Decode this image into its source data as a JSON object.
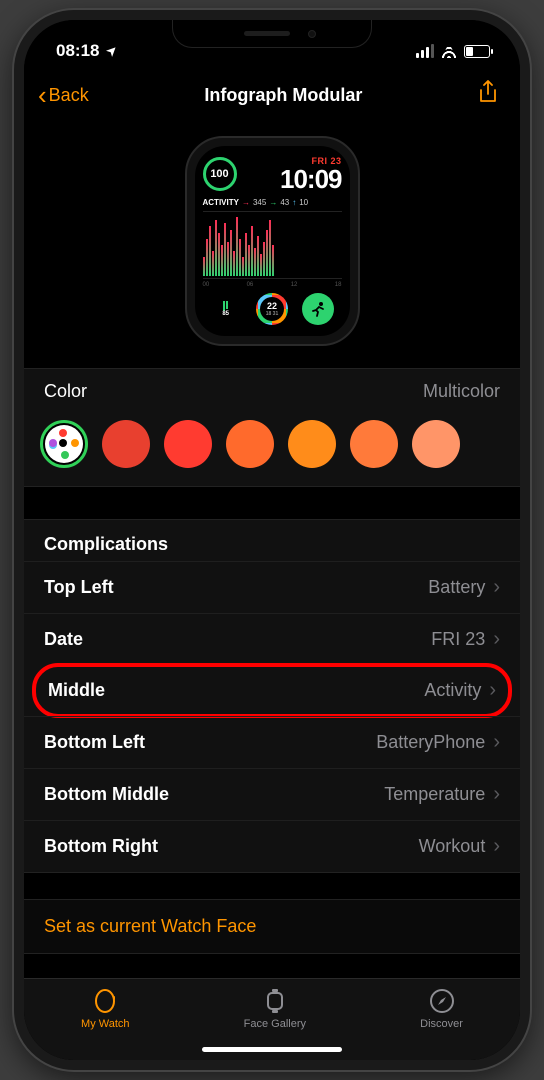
{
  "status": {
    "time": "08:18"
  },
  "nav": {
    "back": "Back",
    "title": "Infograph Modular"
  },
  "watchface": {
    "date_label": "FRI 23",
    "time": "10:09",
    "ring_value": "100",
    "activity_label": "ACTIVITY",
    "activity_move": "345",
    "activity_ex": "43",
    "activity_stand": "10",
    "graph_ticks": [
      "00",
      "06",
      "12",
      "18"
    ],
    "bottom_left_value": "85",
    "bottom_mid_value": "22",
    "bottom_mid_sub": "18 31"
  },
  "color": {
    "label": "Color",
    "value": "Multicolor",
    "swatches": [
      "#e8402f",
      "#ff3b30",
      "#ff6a2c",
      "#ff8c1a",
      "#ff7a3a",
      "#ff9568"
    ]
  },
  "complications": {
    "header": "Complications",
    "rows": [
      {
        "key": "top-left",
        "label": "Top Left",
        "value": "Battery"
      },
      {
        "key": "date",
        "label": "Date",
        "value": "FRI 23"
      },
      {
        "key": "middle",
        "label": "Middle",
        "value": "Activity"
      },
      {
        "key": "bottom-left",
        "label": "Bottom Left",
        "value": "BatteryPhone"
      },
      {
        "key": "bottom-middle",
        "label": "Bottom Middle",
        "value": "Temperature"
      },
      {
        "key": "bottom-right",
        "label": "Bottom Right",
        "value": "Workout"
      }
    ]
  },
  "set_current": "Set as current Watch Face",
  "tabs": {
    "my_watch": "My Watch",
    "face_gallery": "Face Gallery",
    "discover": "Discover"
  }
}
